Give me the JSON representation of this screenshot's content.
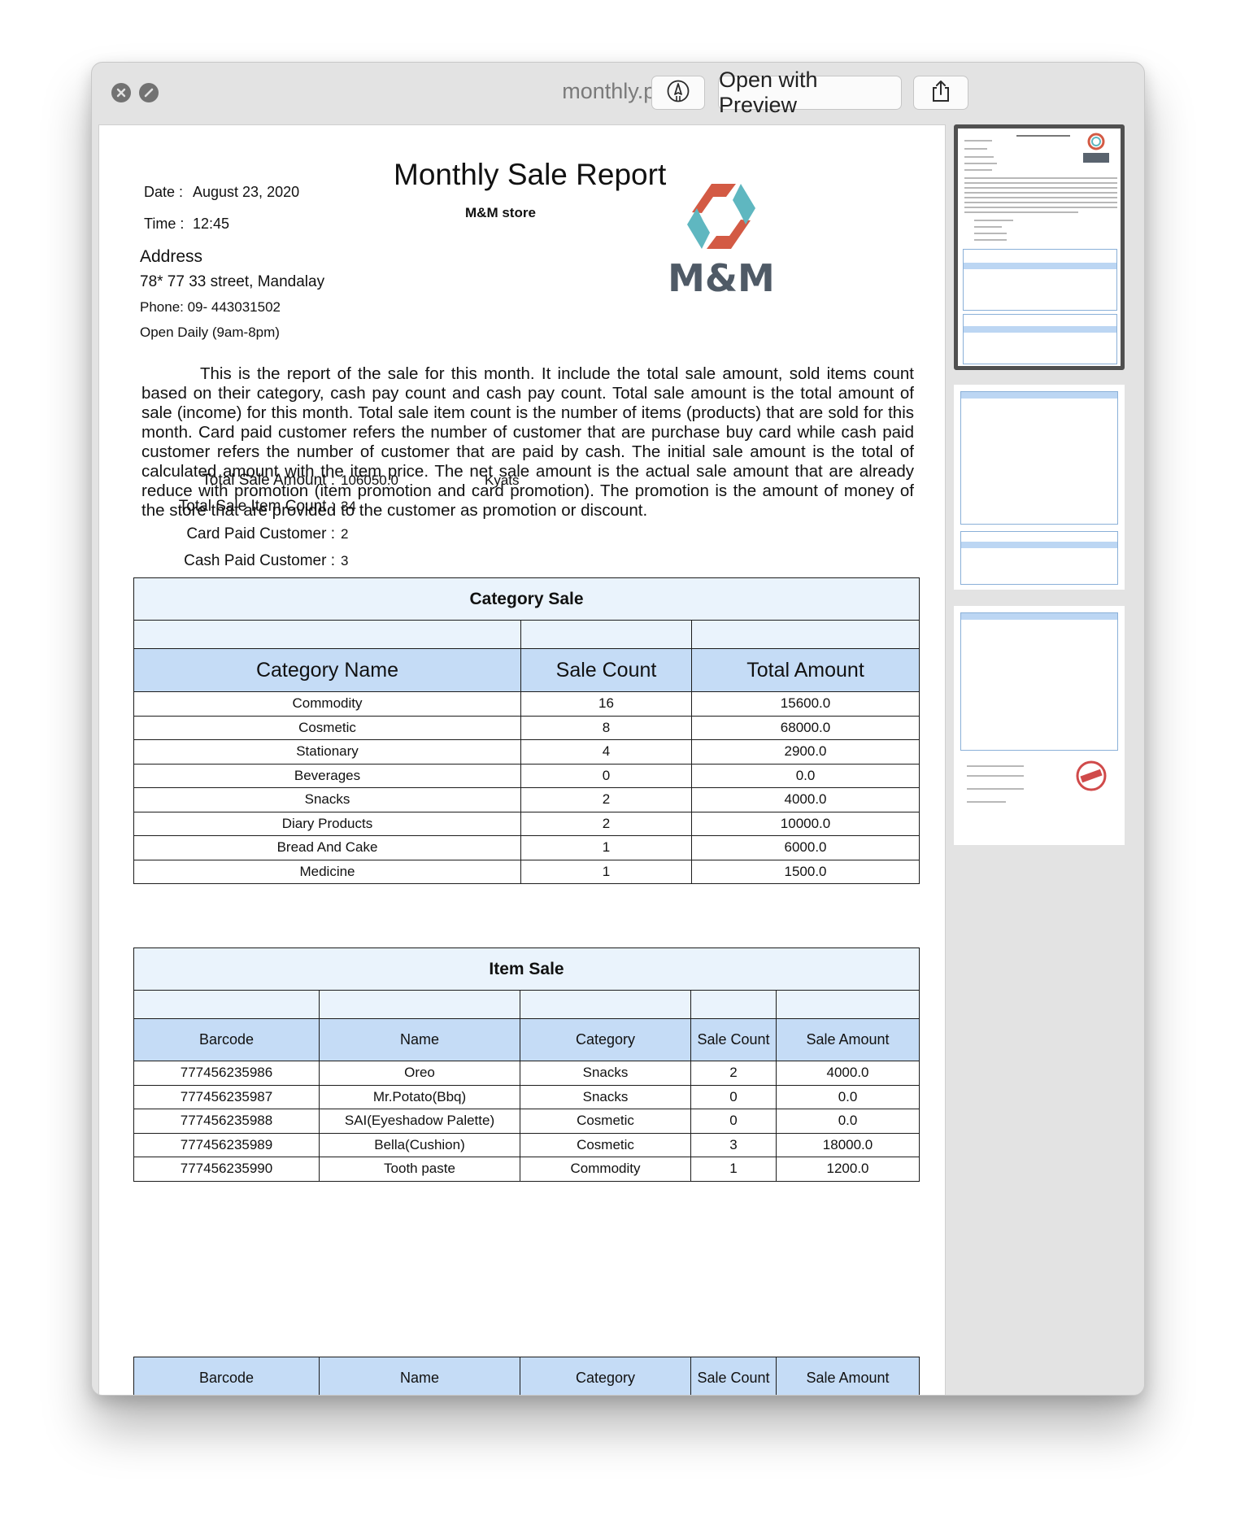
{
  "window": {
    "title": "monthly.pdf",
    "open_button_label": "Open with Preview",
    "markup_icon": "markup-pen-icon",
    "share_icon": "share-icon"
  },
  "report": {
    "title": "Monthly Sale Report",
    "store": "M&M store",
    "logo_text": "M&M",
    "date_label": "Date :",
    "date_value": "August 23, 2020",
    "time_label": "Time :",
    "time_value": "12:45",
    "address_heading": "Address",
    "address_line": "78* 77 33 street, Mandalay",
    "phone": "Phone: 09- 443031502",
    "hours": "Open Daily (9am-8pm)",
    "paragraph": "This is the report of the sale for this month. It include the total sale amount, sold items count based on their category, cash pay count and cash pay count. Total sale amount is the total amount of sale (income) for this month. Total sale item count is the number of items (products) that are sold for this month.  Card paid customer refers the number of customer that are purchase buy card while cash paid customer refers the number of customer that are paid by cash. The initial sale amount is the total of calculated amount with the item price. The net sale amount is the actual sale amount that are already reduce with promotion (item promotion and card promotion). The promotion is the amount of money of the store that are provided to the customer as promotion or discount.",
    "summary": [
      {
        "label": "Total Sale Amount :",
        "value": "106050.0",
        "unit": "Kyats"
      },
      {
        "label": "Total Sale Item Count :",
        "value": "34"
      },
      {
        "label": "Card Paid Customer :",
        "value": "2"
      },
      {
        "label": "Cash Paid Customer :",
        "value": "3"
      }
    ]
  },
  "category_table": {
    "caption": "Category Sale",
    "headers": [
      "Category Name",
      "Sale Count",
      "Total Amount"
    ],
    "rows": [
      [
        "Commodity",
        "16",
        "15600.0"
      ],
      [
        "Cosmetic",
        "8",
        "68000.0"
      ],
      [
        "Stationary",
        "4",
        "2900.0"
      ],
      [
        "Beverages",
        "0",
        "0.0"
      ],
      [
        "Snacks",
        "2",
        "4000.0"
      ],
      [
        "Diary Products",
        "2",
        "10000.0"
      ],
      [
        "Bread And Cake",
        "1",
        "6000.0"
      ],
      [
        "Medicine",
        "1",
        "1500.0"
      ]
    ]
  },
  "item_table": {
    "caption": "Item Sale",
    "headers": [
      "Barcode",
      "Name",
      "Category",
      "Sale Count",
      "Sale Amount"
    ],
    "rows": [
      [
        "777456235986",
        "Oreo",
        "Snacks",
        "2",
        "4000.0"
      ],
      [
        "777456235987",
        "Mr.Potato(Bbq)",
        "Snacks",
        "0",
        "0.0"
      ],
      [
        "777456235988",
        "SAI(Eyeshadow Palette)",
        "Cosmetic",
        "0",
        "0.0"
      ],
      [
        "777456235989",
        "Bella(Cushion)",
        "Cosmetic",
        "3",
        "18000.0"
      ],
      [
        "777456235990",
        "Tooth paste",
        "Commodity",
        "1",
        "1200.0"
      ]
    ]
  },
  "next_page_headers": [
    "Barcode",
    "Name",
    "Category",
    "Sale Count",
    "Sale Amount"
  ],
  "thumbnails": [
    {
      "page": 1,
      "selected": true
    },
    {
      "page": 2,
      "selected": false
    },
    {
      "page": 3,
      "selected": false
    }
  ]
}
